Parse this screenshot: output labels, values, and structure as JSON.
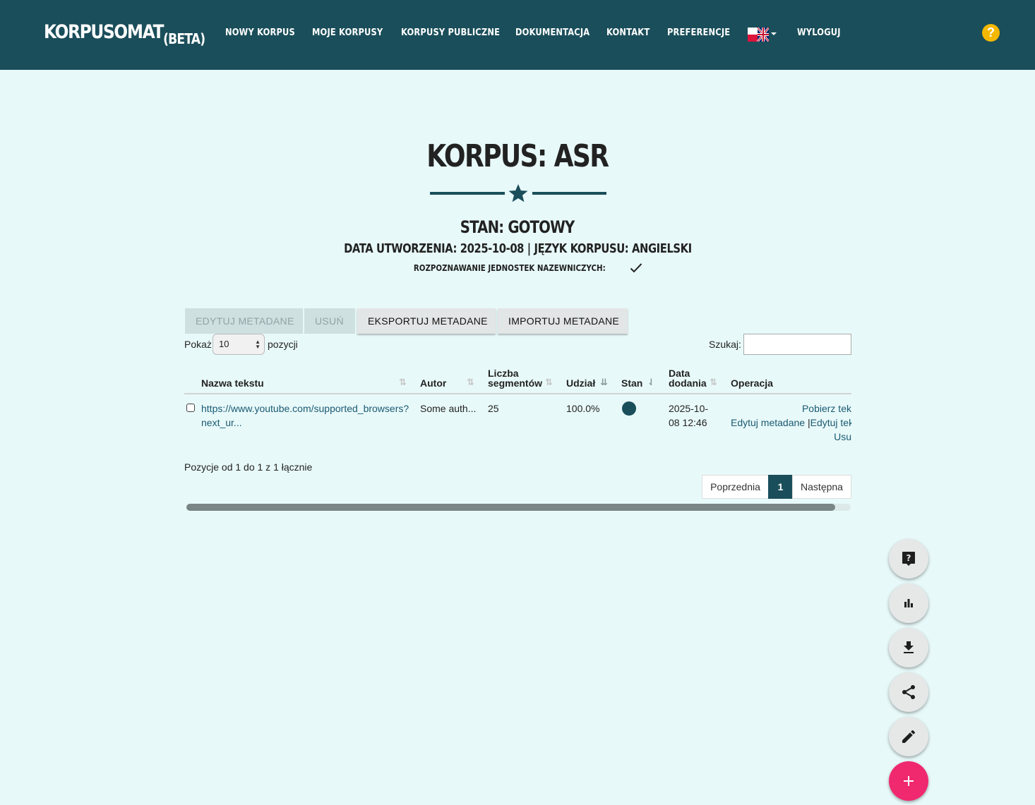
{
  "nav": {
    "brand": "KORPUSOMAT",
    "brand_suffix": "(BETA)",
    "links": [
      "NOWY KORPUS",
      "MOJE KORPUSY",
      "KORPUSY PUBLICZNE",
      "DOKUMENTACJA",
      "KONTAKT",
      "PREFERENCJE",
      "WYLOGUJ"
    ],
    "language_icon": "flag-pl-uk-icon",
    "help": "?"
  },
  "header": {
    "title": "KORPUS: ASR",
    "status": "STAN: GOTOWY",
    "meta": "DATA UTWORZENIA: 2025-10-08 | JĘZYK KORPUSU: ANGIELSKI",
    "ner": "ROZPOZNAWANIE JEDNOSTEK NAZEWNICZYCH:"
  },
  "toolbar": {
    "edit_metadata": "EDYTUJ METADANE",
    "delete": "USUŃ",
    "export_metadata": "EKSPORTUJ METADANE",
    "import_metadata": "IMPORTUJ METADANE"
  },
  "table_controls": {
    "show_label": "Pokaż",
    "page_size": "10",
    "entries_label": "pozycji",
    "search_label": "Szukaj:",
    "search_value": ""
  },
  "table": {
    "headers": {
      "name": "Nazwa tekstu",
      "author": "Autor",
      "segments_1": "Liczba",
      "segments_2": "segmentów",
      "share": "Udział",
      "state": "Stan",
      "date_1": "Data",
      "date_2": "dodania",
      "operation": "Operacja"
    },
    "rows": [
      {
        "name_1": "https://www.youtube.com/supported_browsers?",
        "name_2": "next_ur...",
        "author": "Some auth...",
        "segments": "25",
        "share": "100.0%",
        "state_color": "#1a4e5a",
        "date_1": "2025-10-",
        "date_2": "08 12:46",
        "op_download": "Pobierz tek",
        "op_edit_metadata": "Edytuj metadane",
        "op_separator": "|",
        "op_edit_text": "Edytuj tek",
        "op_delete": "Usu"
      }
    ]
  },
  "footer": {
    "info": "Pozycje od 1 do 1 z 1 łącznie",
    "prev": "Poprzednia",
    "page": "1",
    "next": "Następna"
  },
  "fabs": [
    "help-icon",
    "bar-chart-icon",
    "download-icon",
    "share-icon",
    "edit-icon",
    "plus-icon"
  ],
  "colors": {
    "primary": "#1a4e5a",
    "background": "#e8f9f9",
    "accent": "#f0286e",
    "help": "#f5b800"
  }
}
